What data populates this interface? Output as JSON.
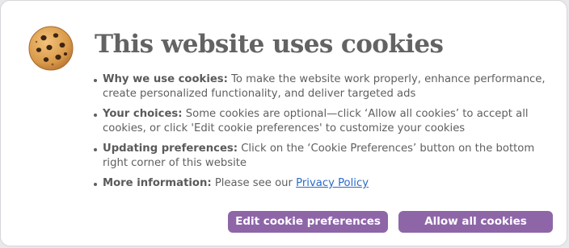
{
  "dialog": {
    "title": "This website uses cookies",
    "icon": "cookie-icon",
    "bullets": [
      {
        "head": "Why we use cookies:",
        "text": " To make the website work properly, enhance performance, create personalized functionality, and deliver targeted ads"
      },
      {
        "head": "Your choices:",
        "text": " Some cookies are optional—click ‘Allow all cookies’ to accept all cookies, or click 'Edit cookie preferences' to customize your cookies"
      },
      {
        "head": "Updating preferences:",
        "text": " Click on the ‘Cookie Preferences’ button on the bottom right corner of this website"
      },
      {
        "head": "More information:",
        "text": " Please see our ",
        "link": "Privacy Policy"
      }
    ]
  },
  "buttons": {
    "edit_label": "Edit cookie preferences",
    "allow_label": "Allow all cookies"
  },
  "colors": {
    "button": "#8e66a8",
    "title": "#636363",
    "link": "#2a6acb"
  }
}
